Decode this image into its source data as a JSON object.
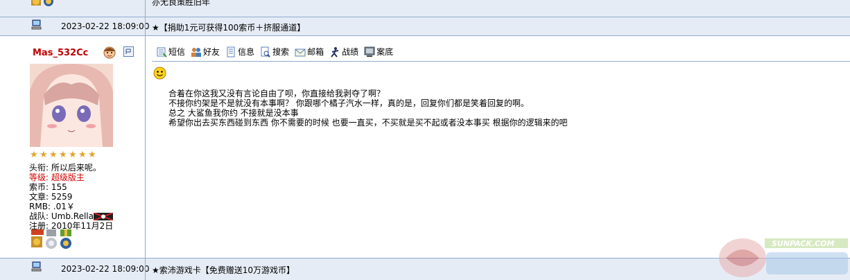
{
  "top_partial_text": "亦无良策胜旧年",
  "post_bars": [
    {
      "time": "2023-02-22 18:09:00",
      "notice": "★【捐助1元可获得100索币＋挤服通道】"
    },
    {
      "time": "2023-02-22 18:09:00",
      "notice": "★索沛游戏卡【免费赠送10万游戏币】"
    }
  ],
  "user": {
    "name": "Mas_532Cc",
    "stars": 7,
    "info": [
      {
        "label": "头衔:",
        "value": "所以后来呢。",
        "red": false
      },
      {
        "label": "等级:",
        "value": "超级版主",
        "red": true
      },
      {
        "label": "索币:",
        "value": "155",
        "red": false
      },
      {
        "label": "文章:",
        "value": "5259",
        "red": false
      },
      {
        "label": "RMB:",
        "value": ".01￥",
        "red": false
      },
      {
        "label": "战队:",
        "value": "Umb.Rella",
        "red": false
      },
      {
        "label": "注册:",
        "value": "2010年11月2日",
        "red": false
      }
    ]
  },
  "toolbar": [
    {
      "label": "短信",
      "icon": "sms-icon"
    },
    {
      "label": "好友",
      "icon": "friends-icon"
    },
    {
      "label": "信息",
      "icon": "info-icon"
    },
    {
      "label": "搜索",
      "icon": "search-icon"
    },
    {
      "label": "邮箱",
      "icon": "mail-icon"
    },
    {
      "label": "战绩",
      "icon": "battle-record-icon"
    },
    {
      "label": "案底",
      "icon": "record-icon"
    }
  ],
  "post_lines": [
    "合着在你这我又没有言论自由了呗，你直接给我剥夺了啊？",
    "不接你约架是不是就没有本事啊？  你跟哪个橘子汽水一样，真的是，回复你们都是笑着回复的啊。",
    "总之 大鲨鱼我你约 不接就是没本事",
    "希望你出去买东西碰到东西 你不需要的时候 也要一直买，不买就是买不起或者没本事买  根据你的逻辑来的吧"
  ],
  "watermark_text": "SUNPACK.COM",
  "colors": {
    "bar_bg": "#e6ecf5",
    "border": "#8eaacf",
    "username": "#c00000",
    "rank_red": "#d40000"
  }
}
